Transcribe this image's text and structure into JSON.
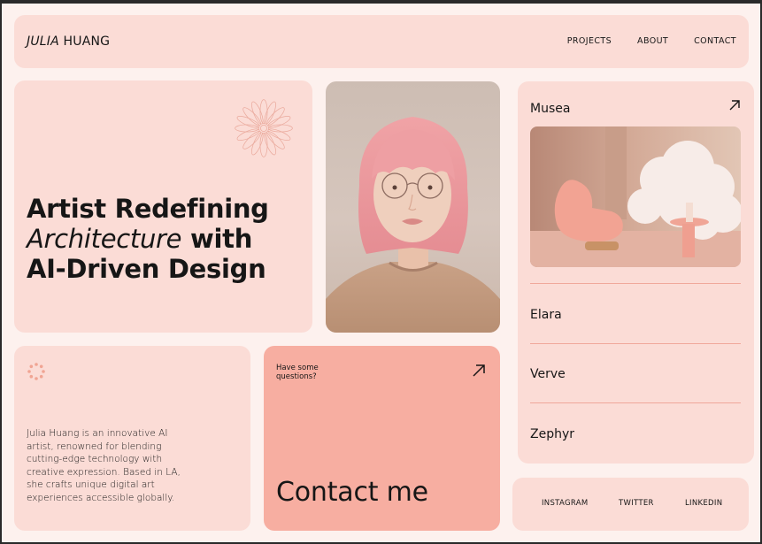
{
  "header": {
    "first_name": "JULIA",
    "last_name": "HUANG",
    "nav": [
      "PROJECTS",
      "ABOUT",
      "CONTACT"
    ]
  },
  "hero": {
    "line1": "Artist Redefining",
    "line2_italic": "Architecture",
    "line2_rest": " with",
    "line3": "AI-Driven Design"
  },
  "portrait": {
    "icon": "portrait-photo"
  },
  "projects": {
    "featured": "Musea",
    "items": [
      "Elara",
      "Verve",
      "Zephyr"
    ]
  },
  "bio": {
    "text": "Julia Huang is an innovative AI artist, renowned for blending cutting-edge technology with creative expression. Based in LA, she crafts unique digital art experiences accessible globally."
  },
  "contact": {
    "question": "Have some questions?",
    "label": "Contact me"
  },
  "socials": [
    "INSTAGRAM",
    "TWITTER",
    "LINKEDIN"
  ],
  "colors": {
    "page_bg": "#fdf1ee",
    "card_bg": "#fbdcd6",
    "contact_bg": "#f7aea1",
    "accent_line": "#f0a89b",
    "text": "#161616"
  }
}
